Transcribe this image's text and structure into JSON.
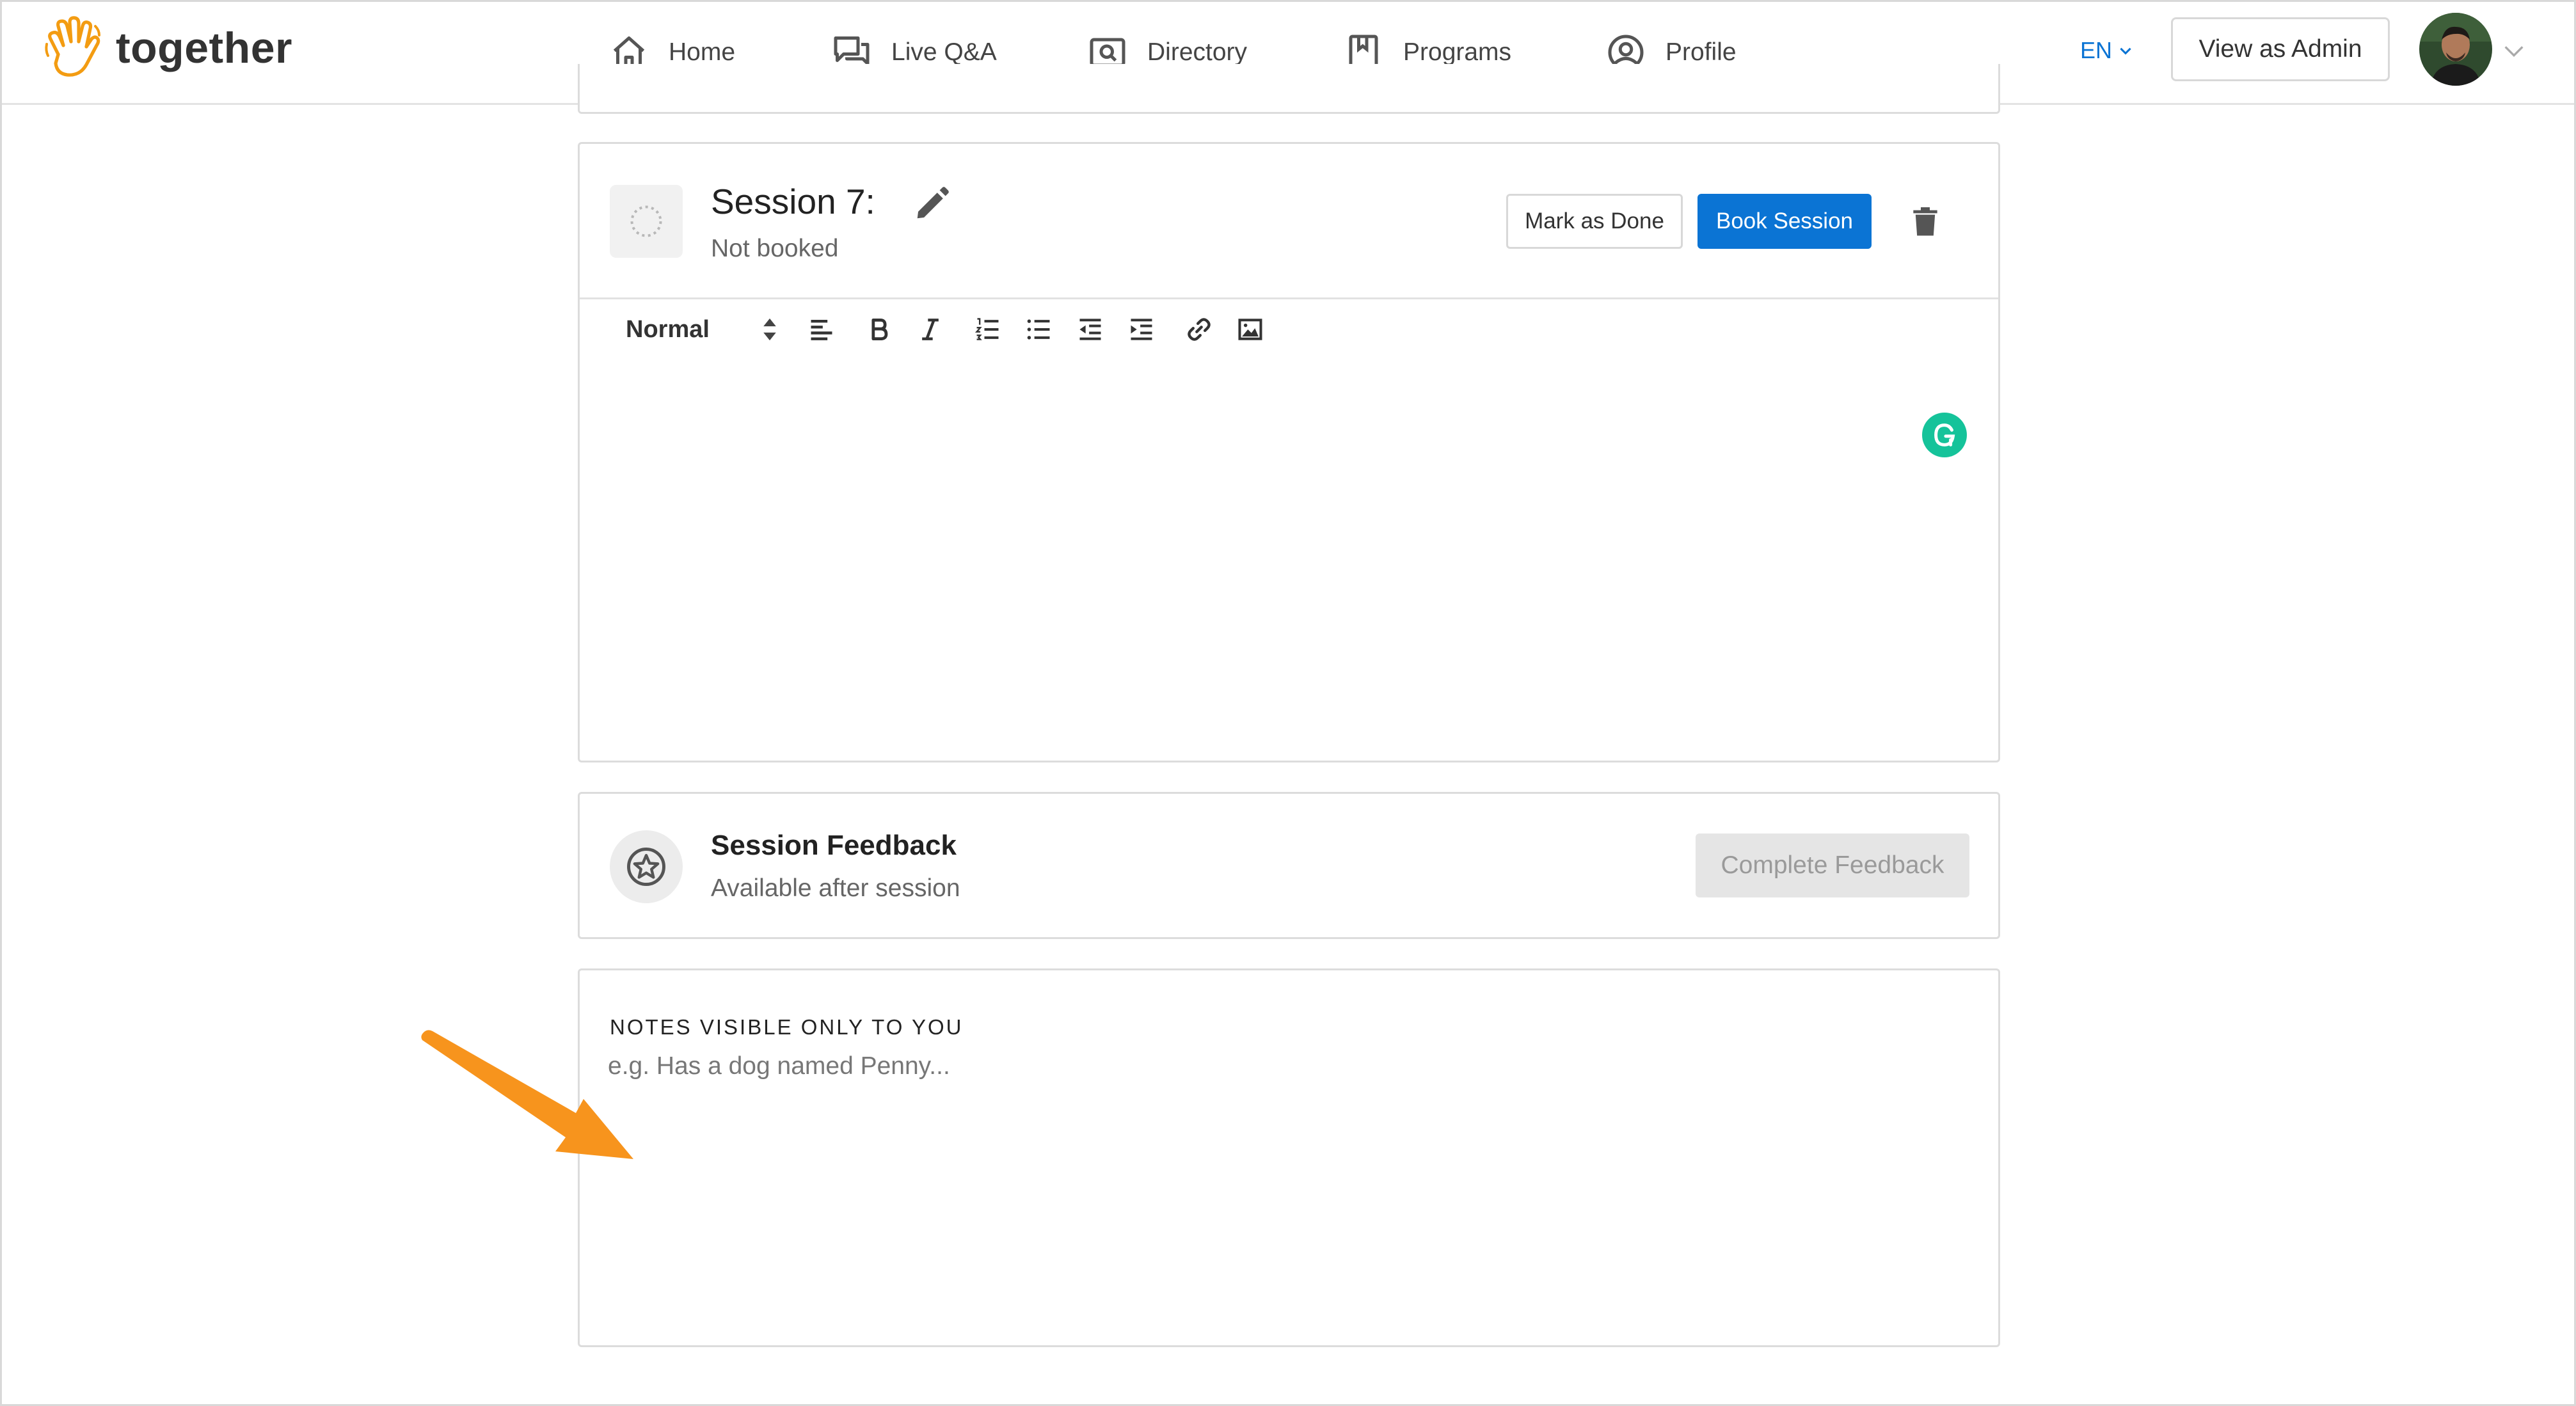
{
  "brand": {
    "name": "together",
    "logo_icon": "waving-hand-icon",
    "accent": "#f39c12"
  },
  "nav": [
    {
      "label": "Home",
      "icon": "home-icon"
    },
    {
      "label": "Live Q&A",
      "icon": "chat-bubbles-icon"
    },
    {
      "label": "Directory",
      "icon": "directory-search-icon"
    },
    {
      "label": "Programs",
      "icon": "bookmark-book-icon"
    },
    {
      "label": "Profile",
      "icon": "user-circle-icon"
    }
  ],
  "header": {
    "language": "EN",
    "view_as_admin": "View as Admin"
  },
  "session": {
    "title": "Session 7:",
    "status": "Not booked",
    "mark_done": "Mark as Done",
    "book": "Book Session",
    "primary_color": "#0b74d4"
  },
  "editor": {
    "format": "Normal",
    "tools": [
      "align-left-icon",
      "bold-icon",
      "italic-icon",
      "ordered-list-icon",
      "bullet-list-icon",
      "outdent-icon",
      "indent-icon",
      "link-icon",
      "image-icon"
    ]
  },
  "feedback": {
    "title": "Session Feedback",
    "subtitle": "Available after session",
    "button": "Complete Feedback"
  },
  "notes": {
    "label": "NOTES VISIBLE ONLY TO YOU",
    "placeholder": "e.g. Has a dog named Penny..."
  },
  "annotation": {
    "arrow_color": "#f7941d"
  }
}
